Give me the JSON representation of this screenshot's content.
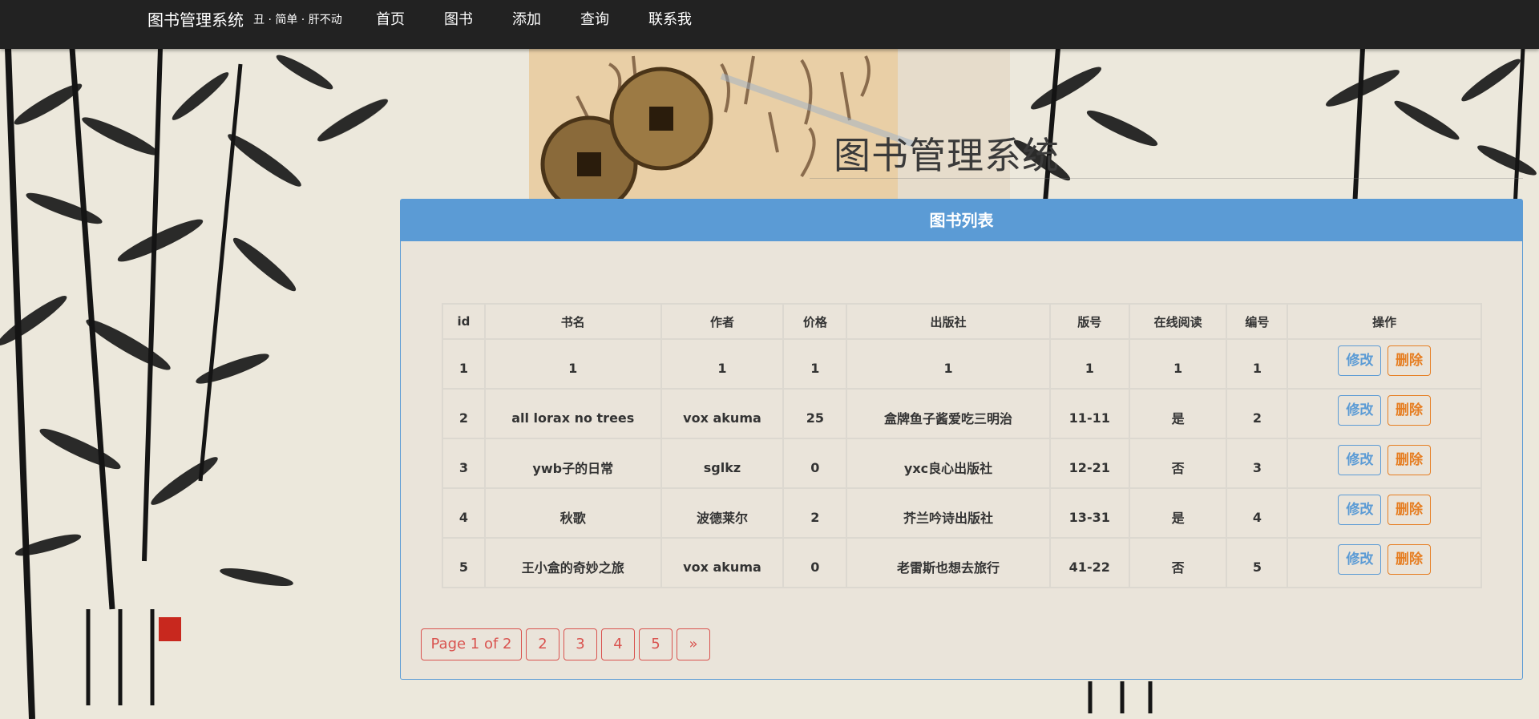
{
  "navbar": {
    "brand": "图书管理系统",
    "tagline": "丑 · 简单 · 肝不动",
    "items": [
      "首页",
      "图书",
      "添加",
      "查询",
      "联系我"
    ]
  },
  "page_title": "图书管理系统",
  "panel": {
    "heading": "图书列表",
    "columns": [
      "id",
      "书名",
      "作者",
      "价格",
      "出版社",
      "版号",
      "在线阅读",
      "编号",
      "操作"
    ],
    "rows": [
      [
        "1",
        "1",
        "1",
        "1",
        "1",
        "1",
        "1",
        "1"
      ],
      [
        "2",
        "all lorax no trees",
        "vox akuma",
        "25",
        "盒牌鱼子酱爱吃三明治",
        "11-11",
        "是",
        "2"
      ],
      [
        "3",
        "ywb子的日常",
        "sglkz",
        "0",
        "yxc良心出版社",
        "12-21",
        "否",
        "3"
      ],
      [
        "4",
        "秋歌",
        "波德莱尔",
        "2",
        "芥兰吟诗出版社",
        "13-31",
        "是",
        "4"
      ],
      [
        "5",
        "王小盒的奇妙之旅",
        "vox akuma",
        "0",
        "老雷斯也想去旅行",
        "41-22",
        "否",
        "5"
      ]
    ],
    "edit_label": "修改",
    "delete_label": "删除"
  },
  "pagination": {
    "status": "Page 1 of 2",
    "pages": [
      "2",
      "3",
      "4",
      "5"
    ],
    "next": "»"
  },
  "colors": {
    "navbar": "#222222",
    "panel_heading": "#5b9bd5",
    "edit": "#5b9bd5",
    "delete": "#e67e22",
    "pager": "#d9534f"
  },
  "background_icons": [
    "bamboo-ink-painting",
    "ancient-coins",
    "calligraphy-scroll",
    "red-seal"
  ]
}
